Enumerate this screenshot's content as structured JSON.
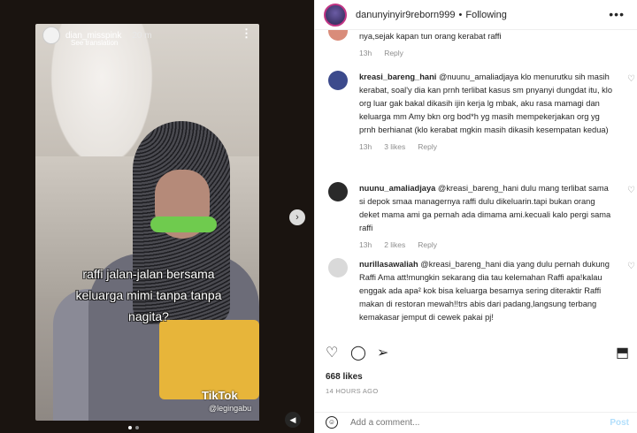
{
  "story": {
    "username": "dian_misspink",
    "time": "20 m",
    "translate": "See translation",
    "caption_lines": [
      "raffi jalan-jalan bersama",
      "keluarga mimi tanpa tanpa",
      "nagita?"
    ],
    "watermark": "TikTok",
    "watermark_handle": "@legingabu"
  },
  "header": {
    "username": "danunyinyir9reborn999",
    "separator": "•",
    "follow_state": "Following"
  },
  "comments": [
    {
      "text": "nya,sejak kapan tun orang kerabat raffi",
      "time": "13h",
      "reply": "Reply",
      "avatar_color": "#d98c7a"
    },
    {
      "user": "kreasi_bareng_hani",
      "text": "@nuunu_amaliadjaya klo menurutku sih masih kerabat, soal'y dia kan prnh terlibat kasus sm pnyanyi dungdat itu, klo org luar gak bakal dikasih ijin kerja lg mbak, aku rasa mamagi dan keluarga mm Amy bkn org bod*h yg masih mempekerjakan org yg prnh berhianat (klo kerabat mgkin masih dikasih kesempatan kedua)",
      "time": "13h",
      "likes": "3 likes",
      "reply": "Reply",
      "avatar_color": "#3c4a8c"
    },
    {
      "user": "nuunu_amaliadjaya",
      "text": "@kreasi_bareng_hani dulu mang terlibat sama si depok smaa managernya raffi dulu dikeluarin.tapi bukan orang deket mama ami ga pernah ada dimama ami.kecuali kalo pergi sama raffi",
      "time": "13h",
      "likes": "2 likes",
      "reply": "Reply",
      "avatar_color": "#2a2a2a"
    },
    {
      "user": "nurillasawaliah",
      "text": "@kreasi_bareng_hani dia yang dulu pernah dukung Raffi Ama att!mungkin sekarang dia tau kelemahan Raffi apa!kalau enggak ada apa² kok bisa keluarga besarnya sering diteraktir Raffi makan di restoran mewah!!trs abis dari padang,langsung terbang kemakasar jemput di cewek pakai pj!",
      "avatar_color": "#d9d9d9"
    }
  ],
  "actions": {
    "likes": "668 likes",
    "date": "14 HOURS AGO"
  },
  "composer": {
    "placeholder": "Add a comment...",
    "post": "Post"
  }
}
